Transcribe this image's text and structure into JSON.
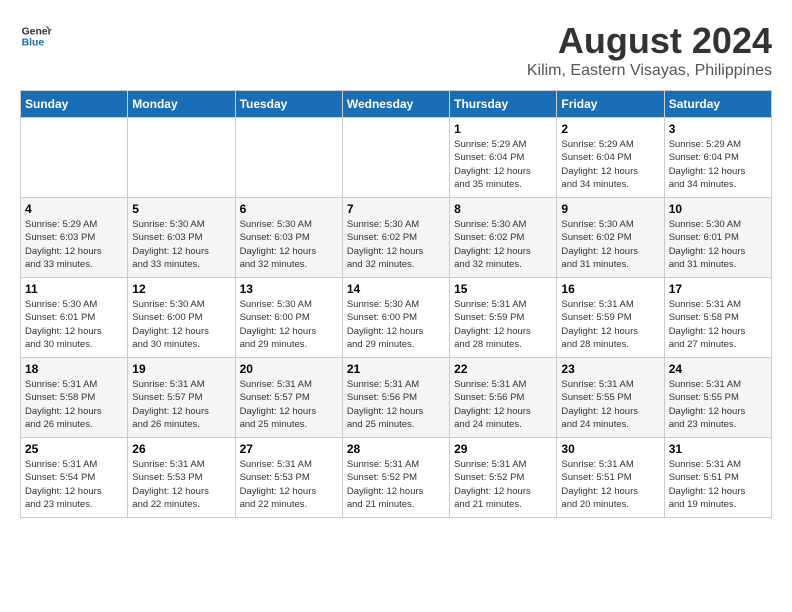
{
  "header": {
    "logo_line1": "General",
    "logo_line2": "Blue",
    "title": "August 2024",
    "subtitle": "Kilim, Eastern Visayas, Philippines"
  },
  "weekdays": [
    "Sunday",
    "Monday",
    "Tuesday",
    "Wednesday",
    "Thursday",
    "Friday",
    "Saturday"
  ],
  "weeks": [
    [
      {
        "day": "",
        "info": ""
      },
      {
        "day": "",
        "info": ""
      },
      {
        "day": "",
        "info": ""
      },
      {
        "day": "",
        "info": ""
      },
      {
        "day": "1",
        "info": "Sunrise: 5:29 AM\nSunset: 6:04 PM\nDaylight: 12 hours\nand 35 minutes."
      },
      {
        "day": "2",
        "info": "Sunrise: 5:29 AM\nSunset: 6:04 PM\nDaylight: 12 hours\nand 34 minutes."
      },
      {
        "day": "3",
        "info": "Sunrise: 5:29 AM\nSunset: 6:04 PM\nDaylight: 12 hours\nand 34 minutes."
      }
    ],
    [
      {
        "day": "4",
        "info": "Sunrise: 5:29 AM\nSunset: 6:03 PM\nDaylight: 12 hours\nand 33 minutes."
      },
      {
        "day": "5",
        "info": "Sunrise: 5:30 AM\nSunset: 6:03 PM\nDaylight: 12 hours\nand 33 minutes."
      },
      {
        "day": "6",
        "info": "Sunrise: 5:30 AM\nSunset: 6:03 PM\nDaylight: 12 hours\nand 32 minutes."
      },
      {
        "day": "7",
        "info": "Sunrise: 5:30 AM\nSunset: 6:02 PM\nDaylight: 12 hours\nand 32 minutes."
      },
      {
        "day": "8",
        "info": "Sunrise: 5:30 AM\nSunset: 6:02 PM\nDaylight: 12 hours\nand 32 minutes."
      },
      {
        "day": "9",
        "info": "Sunrise: 5:30 AM\nSunset: 6:02 PM\nDaylight: 12 hours\nand 31 minutes."
      },
      {
        "day": "10",
        "info": "Sunrise: 5:30 AM\nSunset: 6:01 PM\nDaylight: 12 hours\nand 31 minutes."
      }
    ],
    [
      {
        "day": "11",
        "info": "Sunrise: 5:30 AM\nSunset: 6:01 PM\nDaylight: 12 hours\nand 30 minutes."
      },
      {
        "day": "12",
        "info": "Sunrise: 5:30 AM\nSunset: 6:00 PM\nDaylight: 12 hours\nand 30 minutes."
      },
      {
        "day": "13",
        "info": "Sunrise: 5:30 AM\nSunset: 6:00 PM\nDaylight: 12 hours\nand 29 minutes."
      },
      {
        "day": "14",
        "info": "Sunrise: 5:30 AM\nSunset: 6:00 PM\nDaylight: 12 hours\nand 29 minutes."
      },
      {
        "day": "15",
        "info": "Sunrise: 5:31 AM\nSunset: 5:59 PM\nDaylight: 12 hours\nand 28 minutes."
      },
      {
        "day": "16",
        "info": "Sunrise: 5:31 AM\nSunset: 5:59 PM\nDaylight: 12 hours\nand 28 minutes."
      },
      {
        "day": "17",
        "info": "Sunrise: 5:31 AM\nSunset: 5:58 PM\nDaylight: 12 hours\nand 27 minutes."
      }
    ],
    [
      {
        "day": "18",
        "info": "Sunrise: 5:31 AM\nSunset: 5:58 PM\nDaylight: 12 hours\nand 26 minutes."
      },
      {
        "day": "19",
        "info": "Sunrise: 5:31 AM\nSunset: 5:57 PM\nDaylight: 12 hours\nand 26 minutes."
      },
      {
        "day": "20",
        "info": "Sunrise: 5:31 AM\nSunset: 5:57 PM\nDaylight: 12 hours\nand 25 minutes."
      },
      {
        "day": "21",
        "info": "Sunrise: 5:31 AM\nSunset: 5:56 PM\nDaylight: 12 hours\nand 25 minutes."
      },
      {
        "day": "22",
        "info": "Sunrise: 5:31 AM\nSunset: 5:56 PM\nDaylight: 12 hours\nand 24 minutes."
      },
      {
        "day": "23",
        "info": "Sunrise: 5:31 AM\nSunset: 5:55 PM\nDaylight: 12 hours\nand 24 minutes."
      },
      {
        "day": "24",
        "info": "Sunrise: 5:31 AM\nSunset: 5:55 PM\nDaylight: 12 hours\nand 23 minutes."
      }
    ],
    [
      {
        "day": "25",
        "info": "Sunrise: 5:31 AM\nSunset: 5:54 PM\nDaylight: 12 hours\nand 23 minutes."
      },
      {
        "day": "26",
        "info": "Sunrise: 5:31 AM\nSunset: 5:53 PM\nDaylight: 12 hours\nand 22 minutes."
      },
      {
        "day": "27",
        "info": "Sunrise: 5:31 AM\nSunset: 5:53 PM\nDaylight: 12 hours\nand 22 minutes."
      },
      {
        "day": "28",
        "info": "Sunrise: 5:31 AM\nSunset: 5:52 PM\nDaylight: 12 hours\nand 21 minutes."
      },
      {
        "day": "29",
        "info": "Sunrise: 5:31 AM\nSunset: 5:52 PM\nDaylight: 12 hours\nand 21 minutes."
      },
      {
        "day": "30",
        "info": "Sunrise: 5:31 AM\nSunset: 5:51 PM\nDaylight: 12 hours\nand 20 minutes."
      },
      {
        "day": "31",
        "info": "Sunrise: 5:31 AM\nSunset: 5:51 PM\nDaylight: 12 hours\nand 19 minutes."
      }
    ]
  ]
}
